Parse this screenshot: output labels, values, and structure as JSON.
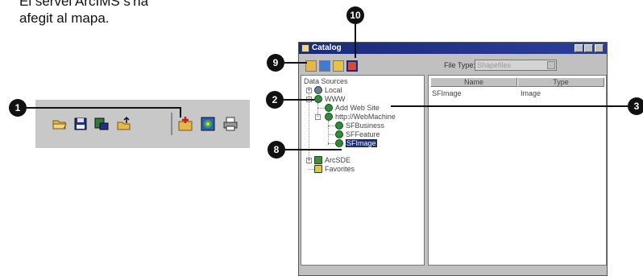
{
  "caption": {
    "line1": "El servei ArcIMS s'ha",
    "line2": "afegit al mapa."
  },
  "callouts": [
    "1",
    "2",
    "3",
    "8",
    "9",
    "10"
  ],
  "toolbar": {
    "buttons": [
      "open-icon",
      "save-icon",
      "print-preview-icon",
      "folder-up-icon",
      "add-data-icon",
      "arcmap-icon",
      "print-icon"
    ]
  },
  "catalog": {
    "title": "Catalog",
    "window_buttons": [
      "minimize-icon",
      "maximize-icon",
      "close-icon"
    ],
    "tools": [
      "add-data-icon",
      "catalog-icon",
      "folder-icon",
      "add-server-icon"
    ],
    "file_type_label": "File Type:",
    "file_type_value": "Shapefiles",
    "tree": {
      "root": "Data Sources",
      "nodes": [
        "Local",
        "WWW",
        "Add Web Site",
        "http://WebMachine",
        "SFBusiness",
        "SFFeature",
        "SFImage",
        "ArcSDE",
        "Favorites"
      ]
    },
    "list": {
      "columns": [
        "Name",
        "Type"
      ],
      "rows": [
        {
          "name": "SFImage",
          "type": "Image"
        }
      ]
    }
  },
  "colors": {
    "titlebar": "#1a2a7a",
    "callout": "#111111",
    "node_icon": "#2e8b3a"
  }
}
